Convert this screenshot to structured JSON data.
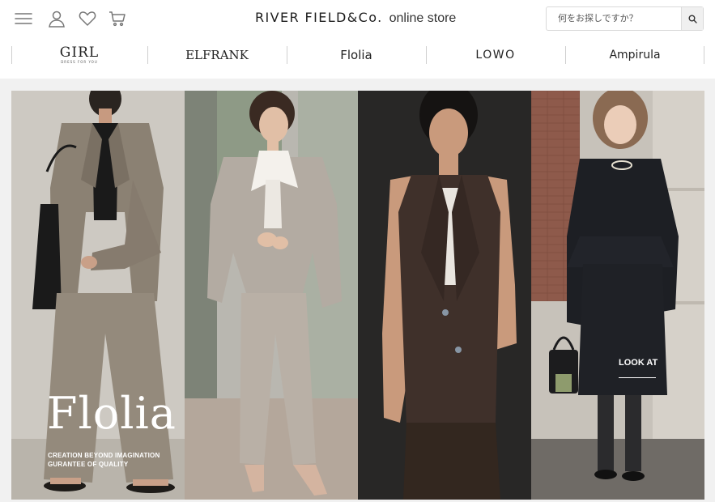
{
  "header": {
    "icons": [
      "menu-icon",
      "user-icon",
      "heart-icon",
      "cart-icon"
    ],
    "logo_main": "RIVER FIELD&Co.",
    "logo_sub": "online store",
    "search": {
      "placeholder": "何をお探しですか？",
      "button_icon": "search-icon"
    }
  },
  "brands": [
    {
      "label": "GIRL",
      "sub": "DRESS FOR YOU"
    },
    {
      "label": "ELFRANK"
    },
    {
      "label": "Flolia"
    },
    {
      "label": "LOWO"
    },
    {
      "label": "Ampirula"
    }
  ],
  "hero": {
    "title": "Flolia",
    "tagline_1": "CREATION BEYOND IMAGINATION",
    "tagline_2": "GURANTEE OF QUALITY",
    "cta": "LOOK AT"
  },
  "colors": {
    "text": "#222222",
    "hero_band_bg": "#f1f1f1",
    "divider": "#cfcfcf",
    "hero_text": "#ffffff"
  }
}
